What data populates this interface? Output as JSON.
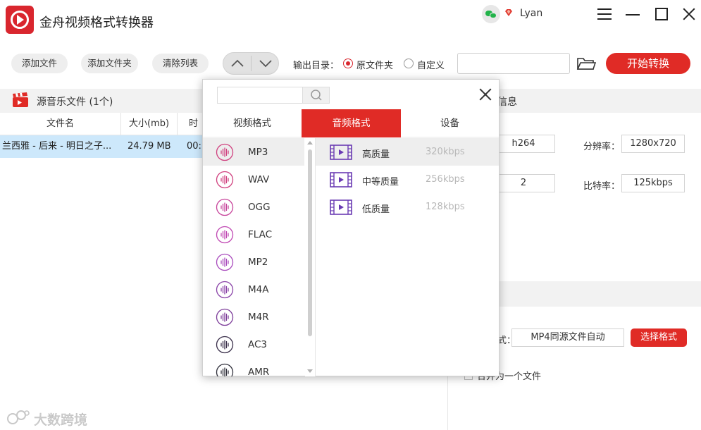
{
  "app": {
    "title": "金舟视频格式转换器",
    "username": "Lyan"
  },
  "toolbar": {
    "add_file": "添加文件",
    "add_folder": "添加文件夹",
    "clear_list": "清除列表",
    "output_dir_label": "输出目录：",
    "option_source": "原文件夹",
    "option_custom": "自定义",
    "output_path": "",
    "start_label": "开始转换"
  },
  "file_panel": {
    "title": "源音乐文件 (1个)",
    "columns": [
      "文件名",
      "大小(mb)",
      "时"
    ],
    "rows": [
      {
        "name": "兰西雅 - 后来 - 明日之子...",
        "size": "24.79 MB",
        "duration": "00:"
      }
    ]
  },
  "right_panel": {
    "header": "信息",
    "codec": "h264",
    "resolution_label": "分辨率：",
    "resolution": "1280x720",
    "channels": "2",
    "bitrate_label": "比特率：",
    "bitrate": "125kbps",
    "format_prefix": "式：",
    "format_value": "MP4同源文件自动",
    "choose_format": "选择格式",
    "merge_label": "合并为一个文件"
  },
  "popup": {
    "search_placeholder": "",
    "tabs": [
      "视频格式",
      "音频格式",
      "设备"
    ],
    "active_tab": 1,
    "formats": [
      "MP3",
      "WAV",
      "OGG",
      "FLAC",
      "MP2",
      "M4A",
      "M4R",
      "AC3",
      "AMR"
    ],
    "selected_format": 0,
    "qualities": [
      {
        "name": "高质量",
        "rate": "320kbps"
      },
      {
        "name": "中等质量",
        "rate": "256kbps"
      },
      {
        "name": "低质量",
        "rate": "128kbps"
      }
    ]
  },
  "watermark": {
    "text": "大数跨境"
  },
  "colors": {
    "accent": "#e02b26",
    "selected_row": "#cde8fb",
    "format_icon": "#9b3fb5"
  }
}
